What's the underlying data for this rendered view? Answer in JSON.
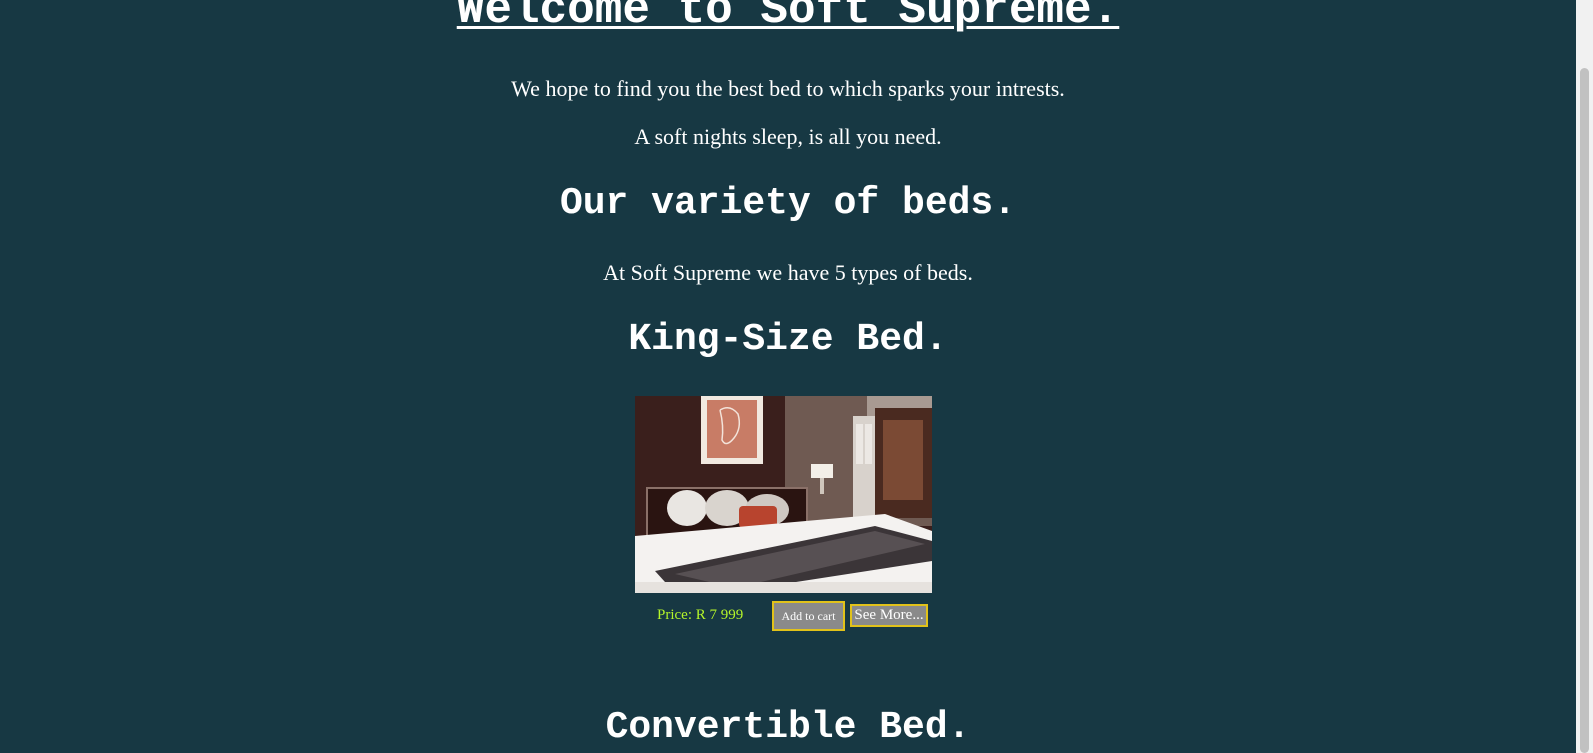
{
  "page": {
    "title": "Welcome to Soft Supreme.",
    "intro_line_1": "We hope to find you the best bed to which sparks your intrests.",
    "intro_line_2": "A soft nights sleep, is all you need.",
    "variety_heading": "Our variety of beds.",
    "variety_text": "At Soft Supreme we have 5 types of beds."
  },
  "beds": [
    {
      "name": "King-Size Bed.",
      "price": "Price: R 7 999",
      "add_to_cart_label": "Add to cart",
      "see_more_label": "See More..."
    },
    {
      "name": "Convertible Bed."
    }
  ],
  "colors": {
    "background": "#173843",
    "price_text": "#b5f52a",
    "button_border": "#e1c21a",
    "button_fill": "#8a8a8a"
  }
}
